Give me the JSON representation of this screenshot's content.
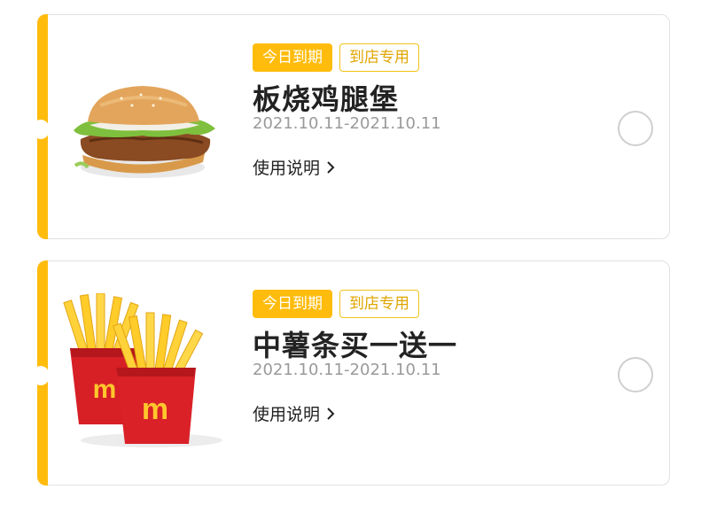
{
  "coupons": [
    {
      "tag_today": "今日到期",
      "tag_store": "到店专用",
      "title": "板烧鸡腿堡",
      "date_range": "2021.10.11-2021.10.11",
      "instructions": "使用说明"
    },
    {
      "tag_today": "今日到期",
      "tag_store": "到店专用",
      "title": "中薯条买一送一",
      "date_range": "2021.10.11-2021.10.11",
      "instructions": "使用说明"
    }
  ],
  "colors": {
    "accent": "#ffbc0d",
    "outline_tag_text": "#e0a500",
    "date_text": "#9a9a9a",
    "card_border": "#e1e1e1"
  },
  "icons": [
    "chevron-right-icon",
    "radio-unchecked-icon"
  ]
}
